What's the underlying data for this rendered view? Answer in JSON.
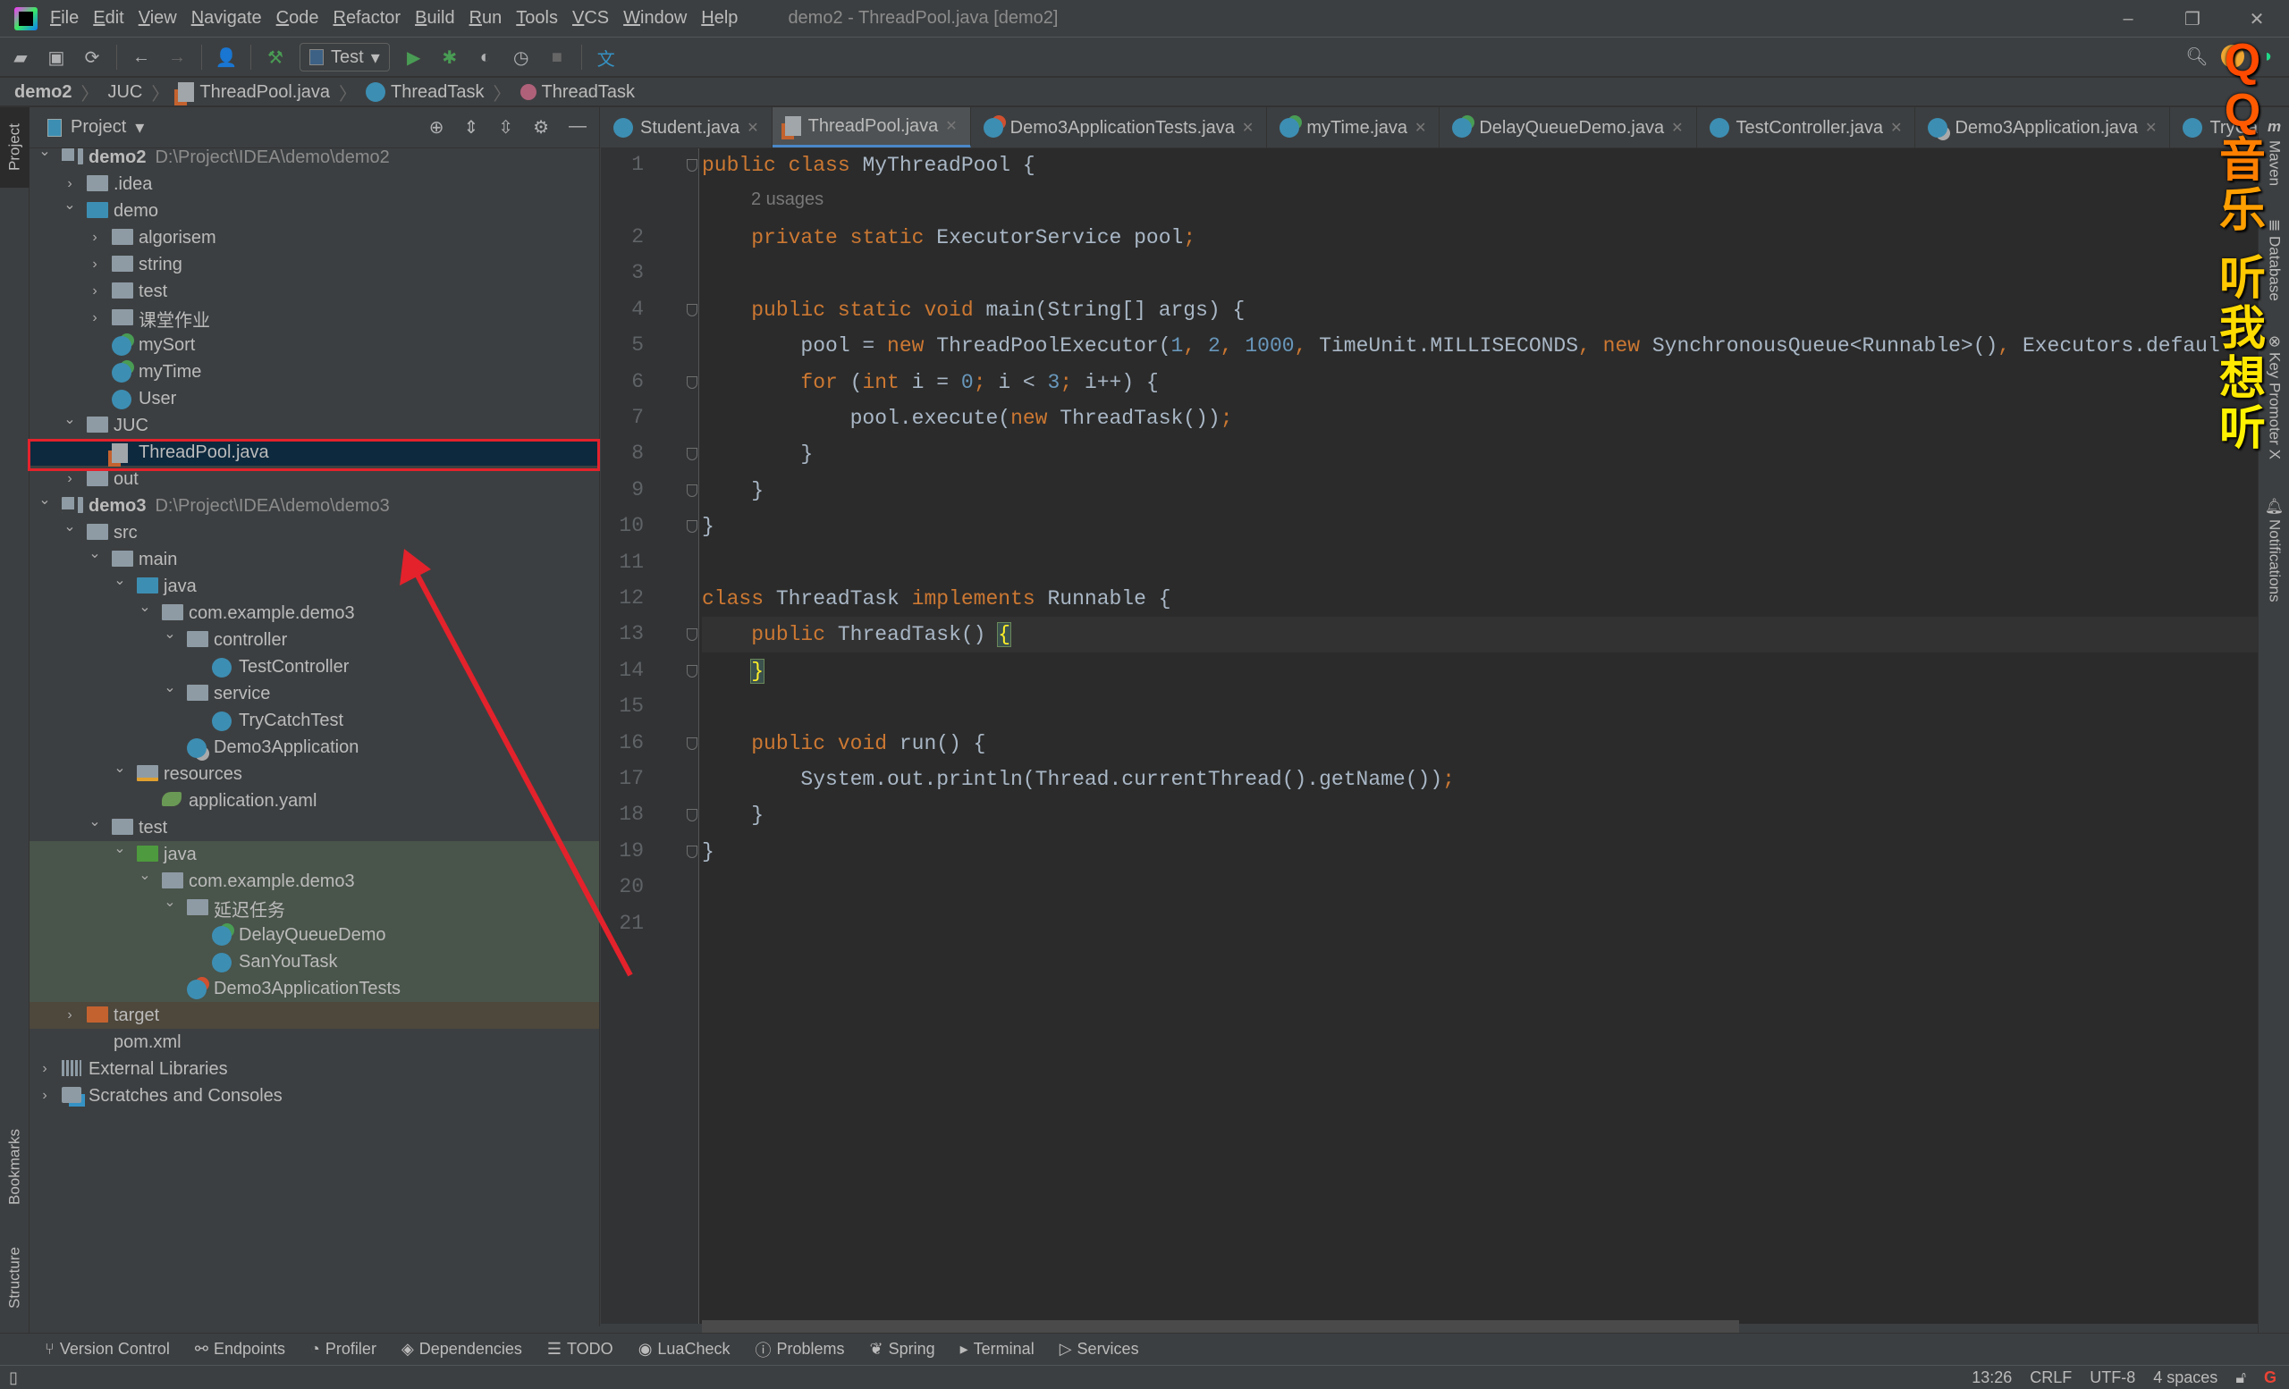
{
  "app": {
    "title": "demo2 - ThreadPool.java [demo2]",
    "menu": [
      "File",
      "Edit",
      "View",
      "Navigate",
      "Code",
      "Refactor",
      "Build",
      "Run",
      "Tools",
      "VCS",
      "Window",
      "Help"
    ],
    "window_controls": [
      "–",
      "❐",
      "✕"
    ]
  },
  "toolbar": {
    "run_config": "Test"
  },
  "breadcrumb": [
    {
      "label": "demo2",
      "icon": "module"
    },
    {
      "label": "JUC",
      "icon": "none"
    },
    {
      "label": "ThreadPool.java",
      "icon": "java-file"
    },
    {
      "label": "ThreadTask",
      "icon": "class"
    },
    {
      "label": "ThreadTask",
      "icon": "method"
    }
  ],
  "project": {
    "title": "Project",
    "rows": [
      {
        "label": "demo2",
        "extra": "D:\\Project\\IDEA\\demo\\demo2",
        "depth": 0,
        "chev": "down",
        "icon": "module",
        "bold": true
      },
      {
        "label": ".idea",
        "depth": 1,
        "chev": "right",
        "icon": "folder"
      },
      {
        "label": "demo",
        "depth": 1,
        "chev": "down",
        "icon": "folder-src"
      },
      {
        "label": "algorisem",
        "depth": 2,
        "chev": "right",
        "icon": "package"
      },
      {
        "label": "string",
        "depth": 2,
        "chev": "right",
        "icon": "package"
      },
      {
        "label": "test",
        "depth": 2,
        "chev": "right",
        "icon": "package"
      },
      {
        "label": "课堂作业",
        "depth": 2,
        "chev": "right",
        "icon": "package"
      },
      {
        "label": "mySort",
        "depth": 2,
        "icon": "class-run"
      },
      {
        "label": "myTime",
        "depth": 2,
        "icon": "class-run"
      },
      {
        "label": "User",
        "depth": 2,
        "icon": "class"
      },
      {
        "label": "JUC",
        "depth": 1,
        "chev": "down",
        "icon": "folder"
      },
      {
        "label": "ThreadPool.java",
        "depth": 2,
        "icon": "java-file",
        "bg": "selected"
      },
      {
        "label": "out",
        "depth": 1,
        "chev": "right",
        "icon": "folder"
      },
      {
        "label": "demo3",
        "extra": "D:\\Project\\IDEA\\demo\\demo3",
        "depth": 0,
        "chev": "down",
        "icon": "module",
        "bold": true
      },
      {
        "label": "src",
        "depth": 1,
        "chev": "down",
        "icon": "folder"
      },
      {
        "label": "main",
        "depth": 2,
        "chev": "down",
        "icon": "folder"
      },
      {
        "label": "java",
        "depth": 3,
        "chev": "down",
        "icon": "folder-src"
      },
      {
        "label": "com.example.demo3",
        "depth": 4,
        "chev": "down",
        "icon": "package"
      },
      {
        "label": "controller",
        "depth": 5,
        "chev": "down",
        "icon": "package"
      },
      {
        "label": "TestController",
        "depth": 6,
        "icon": "class"
      },
      {
        "label": "service",
        "depth": 5,
        "chev": "down",
        "icon": "package"
      },
      {
        "label": "TryCatchTest",
        "depth": 6,
        "icon": "class"
      },
      {
        "label": "Demo3Application",
        "depth": 5,
        "icon": "class-spring"
      },
      {
        "label": "resources",
        "depth": 3,
        "chev": "down",
        "icon": "resources"
      },
      {
        "label": "application.yaml",
        "depth": 4,
        "icon": "yaml"
      },
      {
        "label": "test",
        "depth": 2,
        "chev": "down",
        "icon": "folder"
      },
      {
        "label": "java",
        "depth": 3,
        "chev": "down",
        "icon": "folder-test",
        "bg": "test"
      },
      {
        "label": "com.example.demo3",
        "depth": 4,
        "chev": "down",
        "icon": "package",
        "bg": "test"
      },
      {
        "label": "延迟任务",
        "depth": 5,
        "chev": "down",
        "icon": "package",
        "bg": "test"
      },
      {
        "label": "DelayQueueDemo",
        "depth": 6,
        "icon": "class-run",
        "bg": "test"
      },
      {
        "label": "SanYouTask",
        "depth": 6,
        "icon": "class",
        "bg": "test"
      },
      {
        "label": "Demo3ApplicationTests",
        "depth": 5,
        "icon": "class-test",
        "bg": "test"
      },
      {
        "label": "target",
        "depth": 1,
        "chev": "right",
        "icon": "folder-excluded",
        "bg": "excluded"
      },
      {
        "label": "pom.xml",
        "depth": 1,
        "icon": "maven"
      },
      {
        "label": "External Libraries",
        "depth": 0,
        "chev": "right",
        "icon": "libraries"
      },
      {
        "label": "Scratches and Consoles",
        "depth": 0,
        "chev": "right",
        "icon": "scratches"
      }
    ]
  },
  "tabs": [
    {
      "label": "Student.java",
      "icon": "class"
    },
    {
      "label": "ThreadPool.java",
      "icon": "java-file",
      "active": true
    },
    {
      "label": "Demo3ApplicationTests.java",
      "icon": "class-test"
    },
    {
      "label": "myTime.java",
      "icon": "class-run"
    },
    {
      "label": "DelayQueueDemo.java",
      "icon": "class-run"
    },
    {
      "label": "TestController.java",
      "icon": "class"
    },
    {
      "label": "Demo3Application.java",
      "icon": "class-spring"
    },
    {
      "label": "TryCat",
      "icon": "class"
    }
  ],
  "editor": {
    "usages": "2 usages",
    "current_line": 13,
    "lines": [
      {
        "n": "1",
        "fold": true,
        "t": [
          [
            "k",
            "public class "
          ],
          [
            "p",
            "MyThreadPool {"
          ]
        ]
      },
      {
        "n": "2",
        "t": [
          [
            "p",
            "    "
          ],
          [
            "k",
            "private static "
          ],
          [
            "p",
            "ExecutorService pool"
          ],
          [
            "k",
            ";"
          ]
        ]
      },
      {
        "n": "3",
        "t": []
      },
      {
        "n": "4",
        "fold": true,
        "t": [
          [
            "p",
            "    "
          ],
          [
            "k",
            "public static void "
          ],
          [
            "p",
            "main(String[] args) {"
          ]
        ]
      },
      {
        "n": "5",
        "t": [
          [
            "p",
            "        pool = "
          ],
          [
            "k",
            "new "
          ],
          [
            "p",
            "ThreadPoolExecutor("
          ],
          [
            "n",
            "1"
          ],
          [
            "k",
            ", "
          ],
          [
            "n",
            "2"
          ],
          [
            "k",
            ", "
          ],
          [
            "n",
            "1000"
          ],
          [
            "k",
            ", "
          ],
          [
            "p",
            "TimeUnit.MILLISECONDS"
          ],
          [
            "k",
            ", new "
          ],
          [
            "p",
            "SynchronousQueue<Runnable>()"
          ],
          [
            "k",
            ", "
          ],
          [
            "p",
            "Executors.defaul"
          ]
        ]
      },
      {
        "n": "6",
        "fold": true,
        "t": [
          [
            "p",
            "        "
          ],
          [
            "k",
            "for "
          ],
          [
            "p",
            "("
          ],
          [
            "k",
            "int "
          ],
          [
            "p",
            "i = "
          ],
          [
            "n",
            "0"
          ],
          [
            "k",
            "; "
          ],
          [
            "p",
            "i < "
          ],
          [
            "n",
            "3"
          ],
          [
            "k",
            "; "
          ],
          [
            "p",
            "i++) {"
          ]
        ]
      },
      {
        "n": "7",
        "t": [
          [
            "p",
            "            pool.execute("
          ],
          [
            "k",
            "new "
          ],
          [
            "p",
            "ThreadTask())"
          ],
          [
            "k",
            ";"
          ]
        ]
      },
      {
        "n": "8",
        "fold": true,
        "t": [
          [
            "p",
            "        }"
          ]
        ]
      },
      {
        "n": "9",
        "fold": true,
        "t": [
          [
            "p",
            "    }"
          ]
        ]
      },
      {
        "n": "10",
        "fold": true,
        "t": [
          [
            "p",
            "}"
          ]
        ]
      },
      {
        "n": "11",
        "t": []
      },
      {
        "n": "12",
        "t": [
          [
            "k",
            "class "
          ],
          [
            "p",
            "ThreadTask "
          ],
          [
            "k",
            "implements "
          ],
          [
            "p",
            "Runnable {"
          ]
        ]
      },
      {
        "n": "13",
        "fold": true,
        "t": [
          [
            "p",
            "    "
          ],
          [
            "k",
            "public "
          ],
          [
            "p",
            "ThreadTask() "
          ],
          [
            "m",
            "{"
          ]
        ]
      },
      {
        "n": "14",
        "fold": true,
        "t": [
          [
            "p",
            "    "
          ],
          [
            "m",
            "}"
          ]
        ]
      },
      {
        "n": "15",
        "t": []
      },
      {
        "n": "16",
        "fold": true,
        "t": [
          [
            "p",
            "    "
          ],
          [
            "k",
            "public void "
          ],
          [
            "p",
            "run() {"
          ]
        ]
      },
      {
        "n": "17",
        "t": [
          [
            "p",
            "        System.out.println(Thread.currentThread().getName())"
          ],
          [
            "k",
            ";"
          ]
        ]
      },
      {
        "n": "18",
        "fold": true,
        "t": [
          [
            "p",
            "    }"
          ]
        ]
      },
      {
        "n": "19",
        "fold": true,
        "t": [
          [
            "p",
            "}"
          ]
        ]
      },
      {
        "n": "20",
        "t": []
      },
      {
        "n": "21",
        "t": []
      }
    ]
  },
  "left_stripe": [
    "Project",
    "Bookmarks",
    "Structure"
  ],
  "right_stripe": [
    "Maven",
    "Database",
    "Key Promoter X",
    "Notifications"
  ],
  "bottom_tools": [
    "Version Control",
    "Endpoints",
    "Profiler",
    "Dependencies",
    "TODO",
    "LuaCheck",
    "Problems",
    "Spring",
    "Terminal",
    "Services"
  ],
  "status": {
    "position": "13:26",
    "line_sep": "CRLF",
    "encoding": "UTF-8",
    "indent": "4 spaces"
  },
  "overlay": {
    "text": "QQ音乐 听我想听"
  },
  "colors": {
    "keyword": "#cc7832",
    "number": "#6897bb",
    "text": "#a9b7c6",
    "annotation_red": "#e3222c"
  }
}
